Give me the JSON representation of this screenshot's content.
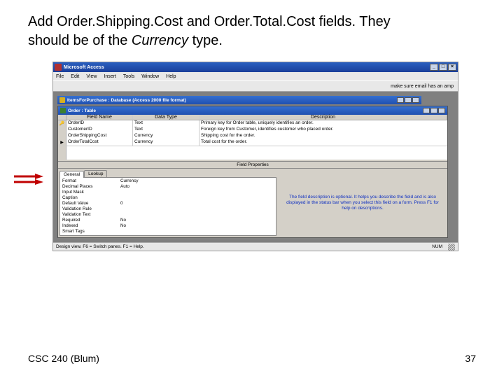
{
  "instruction": {
    "line1": "Add Order.Shipping.Cost and Order.Total.Cost fields.  They",
    "line2_a": "should be of the ",
    "line2_b": "Currency",
    "line2_c": " type."
  },
  "app_title": "Microsoft Access",
  "menu": [
    "File",
    "Edit",
    "View",
    "Insert",
    "Tools",
    "Window",
    "Help"
  ],
  "toolbar_note": "make sure email has an amp",
  "db_window_title": "ItemsForPurchase : Database (Access 2000 file format)",
  "table_window_title": "Order : Table",
  "columns": {
    "c1": "Field Name",
    "c2": "Data Type",
    "c3": "Description"
  },
  "rows": [
    {
      "sel": "key",
      "name": "OrderID",
      "type": "Text",
      "desc": "Primary key for Order table, uniquely identifies an order."
    },
    {
      "sel": "",
      "name": "CustomerID",
      "type": "Text",
      "desc": "Foreign key from Customer, identifies customer who placed order."
    },
    {
      "sel": "",
      "name": "OrderShippingCost",
      "type": "Currency",
      "desc": "Shipping cost for the order."
    },
    {
      "sel": "cur",
      "name": "OrderTotalCost",
      "type": "Currency",
      "desc": "Total cost for the order."
    }
  ],
  "field_props_title": "Field Properties",
  "tabs": {
    "general": "General",
    "lookup": "Lookup"
  },
  "props": [
    {
      "label": "Format",
      "val": "Currency"
    },
    {
      "label": "Decimal Places",
      "val": "Auto"
    },
    {
      "label": "Input Mask",
      "val": ""
    },
    {
      "label": "Caption",
      "val": ""
    },
    {
      "label": "Default Value",
      "val": "0"
    },
    {
      "label": "Validation Rule",
      "val": ""
    },
    {
      "label": "Validation Text",
      "val": ""
    },
    {
      "label": "Required",
      "val": "No"
    },
    {
      "label": "Indexed",
      "val": "No"
    },
    {
      "label": "Smart Tags",
      "val": ""
    }
  ],
  "help_text": "The field description is optional. It helps you describe the field and is also displayed in the status bar when you select this field on a form. Press F1 for help on descriptions.",
  "status_text": "Design view.  F6 = Switch panes.  F1 = Help.",
  "status_num": "NUM",
  "footer_left": "CSC 240 (Blum)",
  "footer_right": "37"
}
